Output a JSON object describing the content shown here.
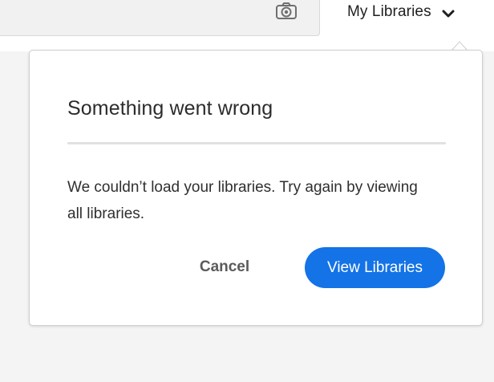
{
  "topbar": {
    "camera_icon": "camera-icon",
    "libraries_dropdown": {
      "label": "My Libraries",
      "icon": "chevron-down-icon"
    }
  },
  "dialog": {
    "title": "Something went wrong",
    "message": "We couldn’t load your libraries. Try again by viewing all libraries.",
    "cancel_label": "Cancel",
    "confirm_label": "View Libraries"
  },
  "colors": {
    "primary": "#1473e6",
    "background": "#f4f4f4",
    "text": "#2c2c2c"
  }
}
